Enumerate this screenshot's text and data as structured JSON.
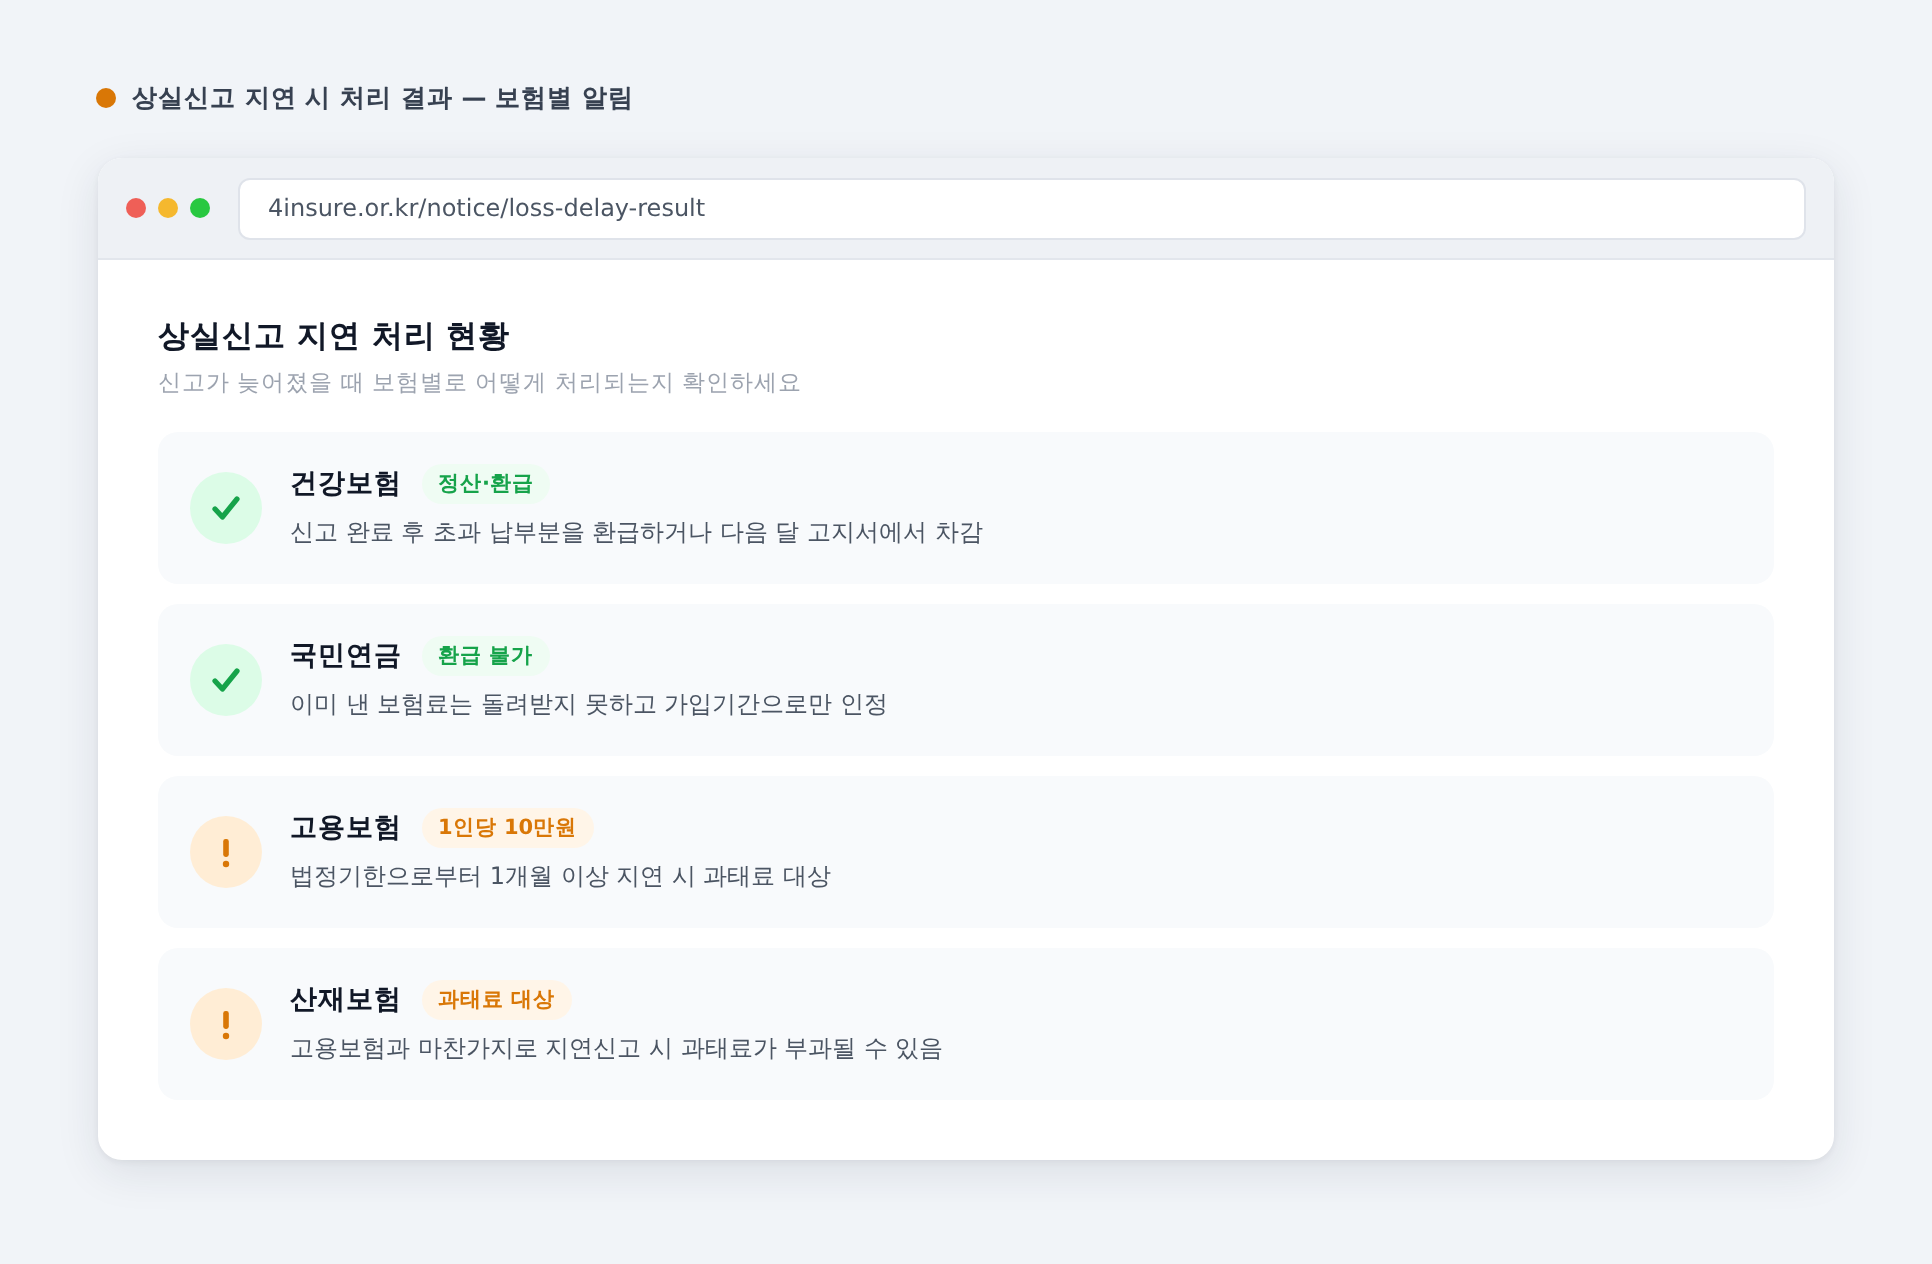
{
  "caption": {
    "text": "상실신고 지연 시 처리 결과 — 보험별 알림"
  },
  "browser": {
    "url": "4insure.or.kr/notice/loss-delay-result"
  },
  "page": {
    "title": "상실신고 지연 처리 현황",
    "subtitle": "신고가 늦어졌을 때 보험별로 어떻게 처리되는지 확인하세요"
  },
  "items": [
    {
      "kind": "ok",
      "name": "건강보험",
      "badge": "정산·환급",
      "description": "신고 완료 후 초과 납부분을 환급하거나 다음 달 고지서에서 차감"
    },
    {
      "kind": "ok",
      "name": "국민연금",
      "badge": "환급 불가",
      "description": "이미 낸 보험료는 돌려받지 못하고 가입기간으로만 인정"
    },
    {
      "kind": "warning",
      "name": "고용보험",
      "badge": "1인당 10만원",
      "description": "법정기한으로부터 1개월 이상 지연 시 과태료 대상"
    },
    {
      "kind": "warning",
      "name": "산재보험",
      "badge": "과태료 대상",
      "description": "고용보험과 마찬가지로 지연신고 시 과태료가 부과될 수 있음"
    }
  ]
}
